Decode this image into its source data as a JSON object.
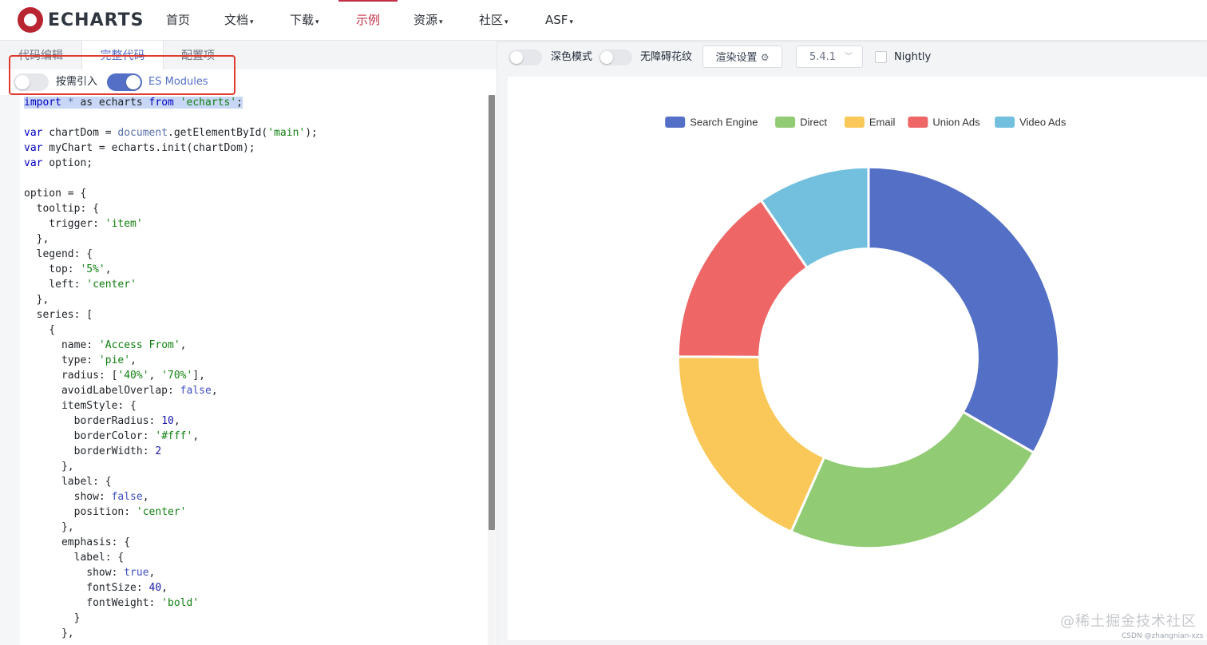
{
  "nav": {
    "logo_text": "ECHARTS",
    "items": [
      {
        "label": "首页",
        "caret": ""
      },
      {
        "label": "文档",
        "caret": "▾"
      },
      {
        "label": "下载",
        "caret": "▾"
      },
      {
        "label": "示例",
        "caret": ""
      },
      {
        "label": "资源",
        "caret": "▾"
      },
      {
        "label": "社区",
        "caret": "▾"
      },
      {
        "label": "ASF",
        "caret": "▾"
      }
    ],
    "active_index": 3,
    "accent_color": "#c23046"
  },
  "editor_panel": {
    "tabs": [
      {
        "label": "代码编辑"
      },
      {
        "label": "完整代码"
      },
      {
        "label": "配置项"
      }
    ],
    "active_tab": 1,
    "options": {
      "on_demand_label": "按需引入",
      "on_demand_enabled": false,
      "es_modules_label": "ES Modules",
      "es_modules_enabled": true
    }
  },
  "toolbar": {
    "dark_mode_label": "深色模式",
    "dark_mode_enabled": false,
    "decal_label": "无障碍花纹",
    "decal_enabled": false,
    "render_settings_label": "渲染设置",
    "version": "5.4.1",
    "nightly_label": "Nightly",
    "nightly_checked": false
  },
  "chart_data": {
    "type": "pie",
    "inner_radius_percent": 40,
    "outer_radius_percent": 70,
    "legend_position": "top-center",
    "series": [
      {
        "name": "Access From",
        "data": [
          {
            "name": "Search Engine",
            "value": 1048,
            "color": "#5470c6"
          },
          {
            "name": "Direct",
            "value": 735,
            "color": "#91cc75"
          },
          {
            "name": "Email",
            "value": 580,
            "color": "#fac858"
          },
          {
            "name": "Union Ads",
            "value": 484,
            "color": "#ee6666"
          },
          {
            "name": "Video Ads",
            "value": 300,
            "color": "#73c0de"
          }
        ]
      }
    ]
  },
  "footer": {
    "watermark": "@稀土掘金技术社区",
    "credit": "CSDN @zhangnian-xzs"
  }
}
